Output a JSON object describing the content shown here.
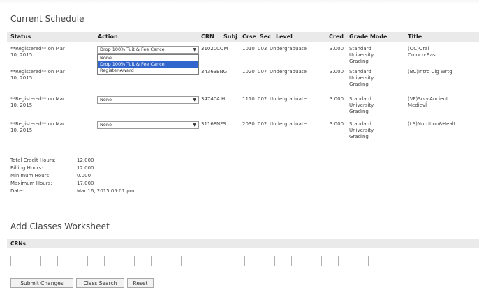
{
  "current_schedule": {
    "title": "Current Schedule",
    "columns": [
      "Status",
      "Action",
      "CRN",
      "Subj",
      "Crse",
      "Sec",
      "Level",
      "Cred",
      "Grade Mode",
      "Title"
    ],
    "rows": [
      {
        "status_line1": "**Registered** on Mar",
        "status_line2": "10, 2015",
        "action_value": "Drop 100% Tuit & Fee Cancel",
        "crn": "31020",
        "subj": "COM",
        "crse": "1010",
        "sec": "003",
        "level": "Undergraduate",
        "cred": "3.000",
        "grade_mode": [
          "Standard",
          "University",
          "Grading"
        ],
        "title": [
          "(OC)Oral",
          "Cmucn:Basc"
        ]
      },
      {
        "status_line1": "**Registered** on Mar",
        "status_line2": "10, 2015",
        "action_value": "",
        "crn": "34363",
        "subj": "ENG",
        "crse": "1020",
        "sec": "007",
        "level": "Undergraduate",
        "cred": "3.000",
        "grade_mode": [
          "Standard",
          "University",
          "Grading"
        ],
        "title": [
          "(BC)Intro Clg Wrtg"
        ]
      },
      {
        "status_line1": "**Registered** on Mar",
        "status_line2": "10, 2015",
        "action_value": "None",
        "crn": "34740",
        "subj": "A H",
        "crse": "1110",
        "sec": "002",
        "level": "Undergraduate",
        "cred": "3.000",
        "grade_mode": [
          "Standard",
          "University",
          "Grading"
        ],
        "title": [
          "(VF)Srvy.Ancient",
          "Medievl"
        ]
      },
      {
        "status_line1": "**Registered** on Mar",
        "status_line2": "10, 2015",
        "action_value": "None",
        "crn": "31168",
        "subj": "NFS",
        "crse": "2030",
        "sec": "002",
        "level": "Undergraduate",
        "cred": "3.000",
        "grade_mode": [
          "Standard",
          "University",
          "Grading"
        ],
        "title": [
          "(LS)Nutrition&Healt"
        ]
      }
    ],
    "dropdown_options": [
      {
        "label": "None",
        "selected": false
      },
      {
        "label": "Drop 100% Tuit & Fee Cancel",
        "selected": true
      },
      {
        "label": "Register-Award",
        "selected": false
      }
    ]
  },
  "summary": [
    {
      "label": "Total Credit Hours:",
      "value": "12.000"
    },
    {
      "label": "Billing Hours:",
      "value": "12.000"
    },
    {
      "label": "Minimum Hours:",
      "value": "0.000"
    },
    {
      "label": "Maximum Hours:",
      "value": "17.000"
    },
    {
      "label": "Date:",
      "value": "Mar 16, 2015 05:01 pm"
    }
  ],
  "worksheet": {
    "title": "Add Classes Worksheet",
    "crns_label": "CRNs",
    "crn_inputs": [
      "",
      "",
      "",
      "",
      "",
      "",
      "",
      "",
      "",
      ""
    ]
  },
  "buttons": {
    "submit": "Submit Changes",
    "class_search": "Class Search",
    "reset": "Reset"
  },
  "colors": {
    "header_bar": "#eaeaea",
    "dropdown_highlight": "#3366cc",
    "text": "#444444"
  },
  "icons": {
    "select_arrow": "chevron-down-icon"
  }
}
